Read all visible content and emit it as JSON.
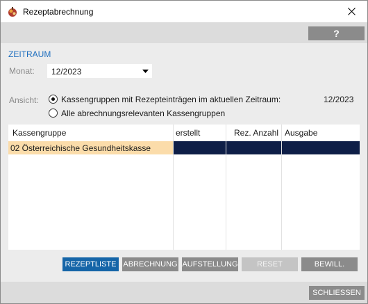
{
  "window": {
    "title": "Rezeptabrechnung",
    "close_label": "close",
    "app_icon": "app-icon"
  },
  "toolbar": {
    "help_label": "?"
  },
  "zeitraum": {
    "section_title": "ZEITRAUM",
    "monat_label": "Monat:",
    "monat_value": "12/2023"
  },
  "ansicht": {
    "label": "Ansicht:",
    "option1": "Kassengruppen mit Rezepteinträgen im aktuellen Zeitraum:",
    "option1_checked": true,
    "option2": "Alle abrechnungsrelevanten Kassengruppen",
    "option2_checked": false,
    "period": "12/2023"
  },
  "table": {
    "columns": [
      "Kassengruppe",
      "erstellt",
      "Rez. Anzahl",
      "Ausgabe"
    ],
    "rows": [
      {
        "kassengruppe": "02  Österreichische Gesundheitskasse",
        "erstellt": "",
        "rez_anzahl": "",
        "ausgabe": ""
      }
    ]
  },
  "actions": {
    "rezeptliste": "REZEPTLISTE",
    "abrechnung": "ABRECHNUNG",
    "aufstellung": "AUFSTELLUNG",
    "reset": "RESET",
    "bewill": "BEWILL."
  },
  "footer": {
    "schliessen": "SCHLIESSEN"
  },
  "colors": {
    "accent": "#1565a8",
    "section_title": "#1f6fbf",
    "row_highlight": "#fbdcaa",
    "row_dark": "#0e1e47",
    "button_gray": "#8b8b8b"
  }
}
